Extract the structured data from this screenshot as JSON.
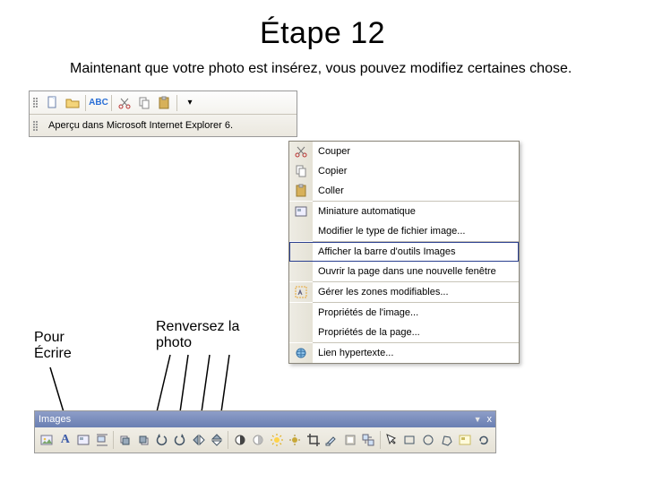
{
  "title": "Étape 12",
  "intro": "Maintenant que votre photo est insérez, vous pouvez modifiez certaines chose.",
  "top_toolbar": {
    "preview_label": "Aperçu dans Microsoft Internet Explorer 6.",
    "icons": {
      "new": "new-page-icon",
      "open": "open-folder-icon",
      "spell": "spellcheck-icon",
      "cut": "cut-icon",
      "copy": "copy-icon",
      "paste": "paste-icon"
    }
  },
  "context_menu": {
    "items": [
      {
        "label": "Couper",
        "icon": "cut-icon",
        "group": 0
      },
      {
        "label": "Copier",
        "icon": "copy-icon",
        "group": 0
      },
      {
        "label": "Coller",
        "icon": "paste-icon",
        "group": 0
      },
      {
        "label": "Miniature automatique",
        "icon": "thumbnail-icon",
        "group": 1
      },
      {
        "label": "Modifier le type de fichier image...",
        "icon": "",
        "group": 1
      },
      {
        "label": "Afficher la barre d'outils Images",
        "icon": "",
        "group": 2,
        "highlighted": true
      },
      {
        "label": "Ouvrir la page dans une nouvelle fenêtre",
        "icon": "",
        "group": 2
      },
      {
        "label": "Gérer les zones modifiables...",
        "icon": "editable-zones-icon",
        "group": 3
      },
      {
        "label": "Propriétés de l'image...",
        "icon": "",
        "group": 4
      },
      {
        "label": "Propriétés de la page...",
        "icon": "",
        "group": 4
      },
      {
        "label": "Lien hypertexte...",
        "icon": "hyperlink-icon",
        "group": 5
      }
    ]
  },
  "annotations": {
    "left": "Pour Écrire",
    "right": "Renversez la photo"
  },
  "image_toolbar": {
    "title": "Images",
    "close": "x",
    "buttons": [
      "insert-image-icon",
      "text-icon",
      "thumbnail-icon",
      "absolute-position-icon",
      "bring-forward-icon",
      "send-backward-icon",
      "rotate-left-icon",
      "rotate-right-icon",
      "flip-horizontal-icon",
      "flip-vertical-icon",
      "contrast-up-icon",
      "contrast-down-icon",
      "brightness-up-icon",
      "brightness-down-icon",
      "crop-icon",
      "transparent-color-icon",
      "bevel-icon",
      "resample-icon",
      "select-icon",
      "rectangle-hotspot-icon",
      "circle-hotspot-icon",
      "polygon-hotspot-icon",
      "highlight-hotspots-icon",
      "restore-icon"
    ]
  }
}
